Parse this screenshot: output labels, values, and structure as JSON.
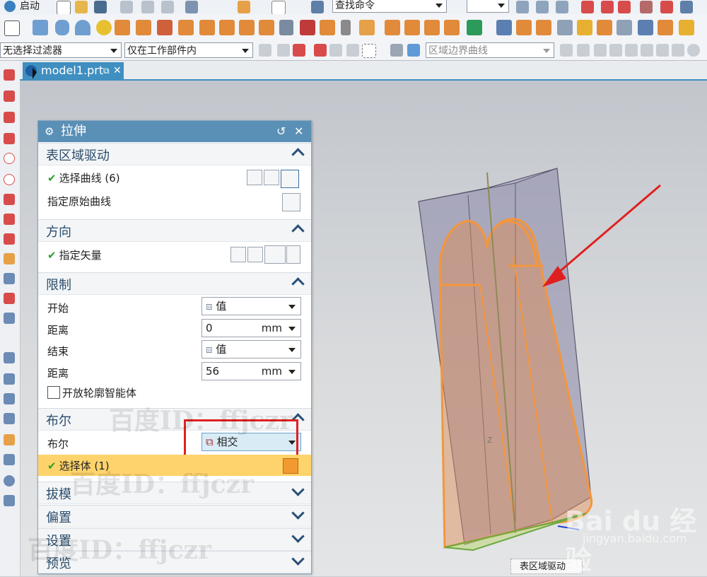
{
  "toolbar": {
    "start_label": "启动",
    "command_search_placeholder": "查找命令",
    "filter_select": "无选择过滤器",
    "scope_select": "仅在工作部件内",
    "curve_rule_select": "区域边界曲线"
  },
  "tab": {
    "filename": "model1.prt"
  },
  "dialog": {
    "title": "拉伸",
    "sections": {
      "section_region": {
        "title": "表区域驱动"
      },
      "direction": {
        "title": "方向"
      },
      "limits": {
        "title": "限制"
      },
      "boolean": {
        "title": "布尔"
      },
      "draft": {
        "title": "拔模"
      },
      "offset": {
        "title": "偏置"
      },
      "settings": {
        "title": "设置"
      },
      "preview": {
        "title": "预览"
      }
    },
    "select_curve": {
      "label": "选择曲线 (6)"
    },
    "specify_origin_curve": {
      "label": "指定原始曲线"
    },
    "specify_vector": {
      "label": "指定矢量"
    },
    "start": {
      "label": "开始",
      "value": "值"
    },
    "start_distance": {
      "label": "距离",
      "value": "0",
      "unit": "mm"
    },
    "end": {
      "label": "结束",
      "value": "值"
    },
    "end_distance": {
      "label": "距离",
      "value": "56",
      "unit": "mm"
    },
    "open_profile": {
      "label": "开放轮廓智能体",
      "checked": false
    },
    "boolean_row": {
      "label": "布尔",
      "value": "相交"
    },
    "select_body": {
      "label": "选择体 (1)"
    }
  },
  "tooltip": {
    "text": "表区域驱动"
  },
  "viewport": {
    "axis_label": "Z"
  },
  "watermarks": {
    "w1": "百度ID：ffjczr",
    "w2": "百度ID：ffjczr",
    "w3": "百度ID：ffjczr"
  },
  "branding": {
    "logo_text": "Bai du 经验",
    "url": "jingyan.baidu.com"
  },
  "colors": {
    "dialog_title_bg": "#5a8fb6",
    "tab_bg": "#3f8fc1",
    "highlight_red": "#e02020",
    "selected_row": "#ffd36b"
  }
}
